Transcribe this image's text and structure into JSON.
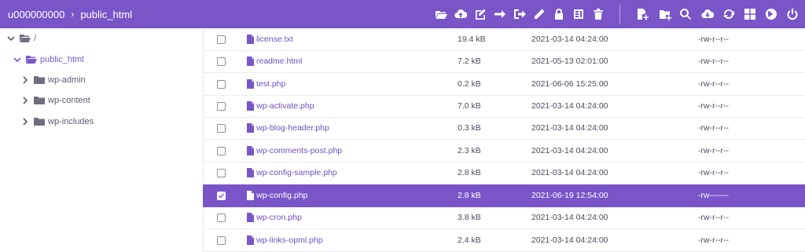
{
  "breadcrumb": {
    "root": "u000000000",
    "separator": "›",
    "current": "public_html"
  },
  "toolbar": {
    "icons": [
      "folder-open-icon",
      "cloud-upload-icon",
      "edit-square-icon",
      "arrow-right-icon",
      "sign-out-icon",
      "pencil-icon",
      "lock-icon",
      "archive-icon",
      "trash-icon",
      "new-file-icon",
      "new-folder-icon",
      "search-icon",
      "cloud-download-icon",
      "refresh-icon",
      "grid-icon",
      "globe-icon",
      "power-icon"
    ]
  },
  "tree": [
    {
      "label": "/",
      "expanded": true
    },
    {
      "label": "public_html",
      "expanded": true,
      "active": true
    },
    {
      "label": "wp-admin",
      "expanded": false
    },
    {
      "label": "wp-content",
      "expanded": false
    },
    {
      "label": "wp-includes",
      "expanded": false
    }
  ],
  "files": [
    {
      "name": "license.txt",
      "size": "19.4 kB",
      "date": "2021-03-14 04:24:00",
      "perm": "-rw-r--r--",
      "selected": false
    },
    {
      "name": "readme.html",
      "size": "7.2 kB",
      "date": "2021-05-13 02:01:00",
      "perm": "-rw-r--r--",
      "selected": false
    },
    {
      "name": "test.php",
      "size": "0.2 kB",
      "date": "2021-06-06 15:25:00",
      "perm": "-rw-r--r--",
      "selected": false
    },
    {
      "name": "wp-activate.php",
      "size": "7.0 kB",
      "date": "2021-03-14 04:24:00",
      "perm": "-rw-r--r--",
      "selected": false
    },
    {
      "name": "wp-blog-header.php",
      "size": "0.3 kB",
      "date": "2021-03-14 04:24:00",
      "perm": "-rw-r--r--",
      "selected": false
    },
    {
      "name": "wp-comments-post.php",
      "size": "2.3 kB",
      "date": "2021-03-14 04:24:00",
      "perm": "-rw-r--r--",
      "selected": false
    },
    {
      "name": "wp-config-sample.php",
      "size": "2.8 kB",
      "date": "2021-03-14 04:24:00",
      "perm": "-rw-r--r--",
      "selected": false
    },
    {
      "name": "wp-config.php",
      "size": "2.8 kB",
      "date": "2021-06-19 12:54:00",
      "perm": "-rw-------",
      "selected": true
    },
    {
      "name": "wp-cron.php",
      "size": "3.8 kB",
      "date": "2021-03-14 04:24:00",
      "perm": "-rw-r--r--",
      "selected": false
    },
    {
      "name": "wp-links-opml.php",
      "size": "2.4 kB",
      "date": "2021-03-14 04:24:00",
      "perm": "-rw-r--r--",
      "selected": false
    }
  ],
  "colors": {
    "accent": "#7a55c8",
    "row_border": "#ececf1"
  }
}
